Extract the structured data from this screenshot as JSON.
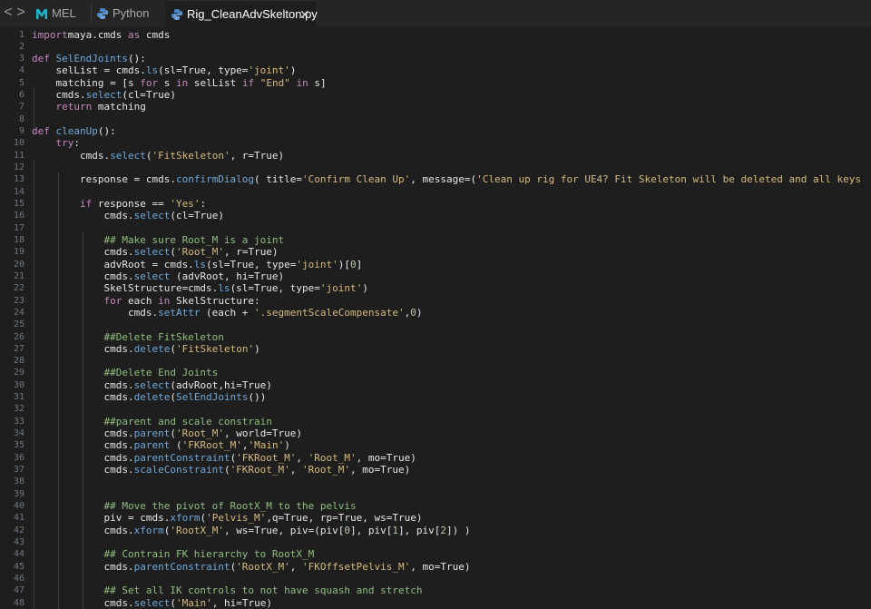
{
  "tabs": [
    {
      "label": "MEL",
      "active": false,
      "icon": "maya-m-icon"
    },
    {
      "label": "Python",
      "active": false,
      "icon": "python-icon"
    },
    {
      "label": "Rig_CleanAdvSkelton.py",
      "active": true,
      "icon": "python-icon"
    }
  ],
  "nav": {
    "back": "<",
    "forward": ">"
  },
  "close_glyph": "✕",
  "colors": {
    "keyword": "#c586c0",
    "function": "#6fa8dc",
    "string": "#d7ba7d",
    "comment": "#8fbf7f",
    "number": "#b5cea8"
  },
  "lines": [
    [
      [
        "kw",
        "import"
      ],
      [
        "",
        "maya.cmds "
      ],
      [
        "kw",
        "as"
      ],
      [
        "",
        " cmds"
      ]
    ],
    [],
    [
      [
        "kw",
        "def"
      ],
      [
        "",
        ""
      ],
      [
        "fn",
        " SelEndJoints"
      ],
      [
        "",
        "():"
      ]
    ],
    [
      [
        "",
        "    selList = cmds."
      ],
      [
        "fn",
        "ls"
      ],
      [
        "",
        "(sl=True, type="
      ],
      [
        "str",
        "'joint'"
      ],
      [
        "",
        ")"
      ]
    ],
    [
      [
        "",
        "    matching = [s "
      ],
      [
        "kw",
        "for"
      ],
      [
        "",
        " s "
      ],
      [
        "kw",
        "in"
      ],
      [
        "",
        " selList "
      ],
      [
        "kw",
        "if"
      ],
      [
        "",
        ""
      ],
      [
        "str",
        " \"End\""
      ],
      [
        "",
        " "
      ],
      [
        "kw",
        "in"
      ],
      [
        "",
        " s]"
      ]
    ],
    [
      [
        "",
        "    cmds."
      ],
      [
        "fn",
        "select"
      ],
      [
        "",
        "(cl=True)"
      ]
    ],
    [
      [
        "",
        "    "
      ],
      [
        "kw",
        "return"
      ],
      [
        "",
        " matching"
      ]
    ],
    [],
    [
      [
        "kw",
        "def"
      ],
      [
        "fn",
        " cleanUp"
      ],
      [
        "",
        "():"
      ]
    ],
    [
      [
        "kw",
        "    try"
      ],
      [
        "",
        ":"
      ]
    ],
    [
      [
        "",
        "        cmds."
      ],
      [
        "fn",
        "select"
      ],
      [
        "",
        "("
      ],
      [
        "str",
        "'FitSkeleton'"
      ],
      [
        "",
        ", r=True)"
      ]
    ],
    [],
    [
      [
        "",
        "        response = cmds."
      ],
      [
        "fn",
        "confirmDialog"
      ],
      [
        "",
        "( title="
      ],
      [
        "str",
        "'Confirm Clean Up'"
      ],
      [
        "",
        ", message=("
      ],
      [
        "str",
        "'Clean up rig for UE4? Fit Skeleton will be deleted and all keys"
      ]
    ],
    [],
    [
      [
        "kw",
        "        if"
      ],
      [
        "",
        " response == "
      ],
      [
        "str",
        "'Yes'"
      ],
      [
        "",
        ":"
      ]
    ],
    [
      [
        "",
        "            cmds."
      ],
      [
        "fn",
        "select"
      ],
      [
        "",
        "(cl=True)"
      ]
    ],
    [],
    [
      [
        "cm",
        "            ## Make sure Root_M is a joint"
      ]
    ],
    [
      [
        "",
        "            cmds."
      ],
      [
        "fn",
        "select"
      ],
      [
        "",
        "("
      ],
      [
        "str",
        "'Root_M'"
      ],
      [
        "",
        ", r=True)"
      ]
    ],
    [
      [
        "",
        "            advRoot = cmds."
      ],
      [
        "fn",
        "ls"
      ],
      [
        "",
        "(sl=True, type="
      ],
      [
        "str",
        "'joint'"
      ],
      [
        "",
        ")["
      ],
      [
        "num",
        "0"
      ],
      [
        "",
        "]"
      ]
    ],
    [
      [
        "",
        "            cmds."
      ],
      [
        "fn",
        "select"
      ],
      [
        "",
        " (advRoot, hi=True)"
      ]
    ],
    [
      [
        "",
        "            SkelStructure=cmds."
      ],
      [
        "fn",
        "ls"
      ],
      [
        "",
        "(sl=True, type="
      ],
      [
        "str",
        "'joint'"
      ],
      [
        "",
        ")"
      ]
    ],
    [
      [
        "kw",
        "            for"
      ],
      [
        "",
        " each "
      ],
      [
        "kw",
        "in"
      ],
      [
        "",
        " SkelStructure:"
      ]
    ],
    [
      [
        "",
        "                cmds."
      ],
      [
        "fn",
        "setAttr"
      ],
      [
        "",
        " (each + "
      ],
      [
        "str",
        "'.segmentScaleCompensate'"
      ],
      [
        "",
        ","
      ],
      [
        "num",
        "0"
      ],
      [
        "",
        ")"
      ]
    ],
    [],
    [
      [
        "cm",
        "            ##Delete FitSkeleton"
      ]
    ],
    [
      [
        "",
        "            cmds."
      ],
      [
        "fn",
        "delete"
      ],
      [
        "",
        "("
      ],
      [
        "str",
        "'FitSkeleton'"
      ],
      [
        "",
        ")"
      ]
    ],
    [],
    [
      [
        "cm",
        "            ##Delete End Joints"
      ]
    ],
    [
      [
        "",
        "            cmds."
      ],
      [
        "fn",
        "select"
      ],
      [
        "",
        "(advRoot,hi=True)"
      ]
    ],
    [
      [
        "",
        "            cmds."
      ],
      [
        "fn",
        "delete"
      ],
      [
        "",
        "("
      ],
      [
        "fn",
        "SelEndJoints"
      ],
      [
        "",
        "())"
      ]
    ],
    [],
    [
      [
        "cm",
        "            ##parent and scale constrain"
      ]
    ],
    [
      [
        "",
        "            cmds."
      ],
      [
        "fn",
        "parent"
      ],
      [
        "",
        "("
      ],
      [
        "str",
        "'Root_M'"
      ],
      [
        "",
        ", world=True)"
      ]
    ],
    [
      [
        "",
        "            cmds."
      ],
      [
        "fn",
        "parent"
      ],
      [
        "",
        " ("
      ],
      [
        "str",
        "'FKRoot_M'"
      ],
      [
        "",
        ","
      ],
      [
        "str",
        "'Main'"
      ],
      [
        "",
        ")"
      ]
    ],
    [
      [
        "",
        "            cmds."
      ],
      [
        "fn",
        "parentConstraint"
      ],
      [
        "",
        "("
      ],
      [
        "str",
        "'FKRoot_M'"
      ],
      [
        "",
        ", "
      ],
      [
        "str",
        "'Root_M'"
      ],
      [
        "",
        ", mo=True)"
      ]
    ],
    [
      [
        "",
        "            cmds."
      ],
      [
        "fn",
        "scaleConstraint"
      ],
      [
        "",
        "("
      ],
      [
        "str",
        "'FKRoot_M'"
      ],
      [
        "",
        ", "
      ],
      [
        "str",
        "'Root_M'"
      ],
      [
        "",
        ", mo=True)"
      ]
    ],
    [],
    [],
    [
      [
        "cm",
        "            ## Move the pivot of RootX_M to the pelvis"
      ]
    ],
    [
      [
        "",
        "            piv = cmds."
      ],
      [
        "fn",
        "xform"
      ],
      [
        "",
        "("
      ],
      [
        "str",
        "'Pelvis_M'"
      ],
      [
        "",
        ",q=True, rp=True, ws=True)"
      ]
    ],
    [
      [
        "",
        "            cmds."
      ],
      [
        "fn",
        "xform"
      ],
      [
        "",
        "("
      ],
      [
        "str",
        "'RootX_M'"
      ],
      [
        "",
        ", ws=True, piv=(piv["
      ],
      [
        "num",
        "0"
      ],
      [
        "",
        "], piv["
      ],
      [
        "num",
        "1"
      ],
      [
        "",
        "], piv["
      ],
      [
        "num",
        "2"
      ],
      [
        "",
        "]) )"
      ]
    ],
    [],
    [
      [
        "cm",
        "            ## Contrain FK hierarchy to RootX_M"
      ]
    ],
    [
      [
        "",
        "            cmds."
      ],
      [
        "fn",
        "parentConstraint"
      ],
      [
        "",
        "("
      ],
      [
        "str",
        "'RootX_M'"
      ],
      [
        "",
        ", "
      ],
      [
        "str",
        "'FKOffsetPelvis_M'"
      ],
      [
        "",
        ", mo=True)"
      ]
    ],
    [],
    [
      [
        "cm",
        "            ## Set all IK controls to not have squash and stretch"
      ]
    ],
    [
      [
        "",
        "            cmds."
      ],
      [
        "fn",
        "select"
      ],
      [
        "",
        "("
      ],
      [
        "str",
        "'Main'"
      ],
      [
        "",
        ", hi=True)"
      ]
    ]
  ]
}
